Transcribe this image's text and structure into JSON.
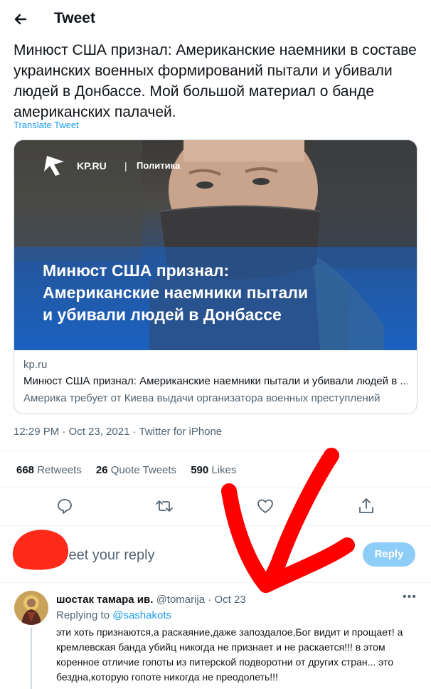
{
  "header": {
    "title": "Tweet",
    "back_icon": "arrow-left-icon"
  },
  "tweet": {
    "text": "Минюст США признал: Американские наемники в составе украинских военных формирований пытали и убивали людей в Донбассе. Мой большой материал о банде американских палачей.",
    "translate_label": "Translate Tweet",
    "card": {
      "image_brand": "KP.RU",
      "image_section": "Политика",
      "image_headline": [
        "Минюст США признал:",
        "Американские наемники пытали",
        "и убивали людей в Донбассе"
      ],
      "domain": "kp.ru",
      "title": "Минюст США признал: Американские наемники пытали и убивали людей в ...",
      "description": "Америка требует от Киева выдачи организатора военных преступлений"
    },
    "meta": "12:29 PM · Oct 23, 2021 · Twitter for iPhone",
    "stats": {
      "retweets_count": "668",
      "retweets_label": "Retweets",
      "quotes_count": "26",
      "quotes_label": "Quote Tweets",
      "likes_count": "590",
      "likes_label": "Likes"
    },
    "actions": [
      "reply-icon",
      "retweet-icon",
      "like-icon",
      "share-icon"
    ]
  },
  "reply_box": {
    "placeholder": "weet your reply",
    "button_label": "Reply"
  },
  "reply_tweet": {
    "name": "шостак тамара ив.",
    "handle": "@tomarija",
    "separator": " · ",
    "date": "Oct 23",
    "more": "•••",
    "replying_prefix": "Replying to ",
    "replying_to": "@sashakots",
    "text": "эти хоть признаются,а раскаяние,даже запоздалое,Бог видит и прощает! а кремлевская банда убийц никогда не признает и не раскается!!! в этом коренное отличие гопоты из питерской подворотни от других стран... это бездна,которую гопоте никогда не преодолеть!!!"
  },
  "colors": {
    "accent": "#1d9bf0",
    "reply_button": "#8ecdf8",
    "annotation": "#ff0000",
    "card_headline_bg": "#1b64c4"
  }
}
